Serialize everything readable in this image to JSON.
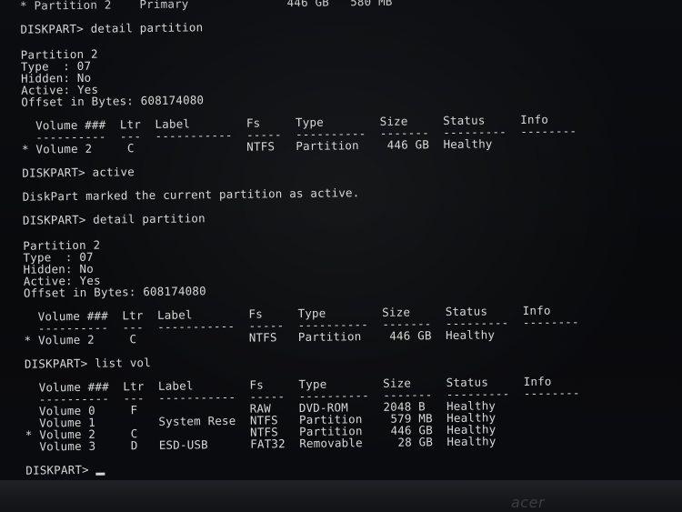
{
  "terminal": {
    "lines": [
      "* Partition 2    Primary              446 GB   580 MB",
      "DISKPART> detail partition",
      "Partition 2",
      "Type  : 07",
      "Hidden: No",
      "Active: Yes",
      "Offset in Bytes: 608174080",
      "  Volume ###  Ltr  Label        Fs     Type        Size     Status     Info",
      "  ----------  ---  -----------  -----  ----------  -------  ---------  --------",
      "* Volume 2     C                NTFS   Partition    446 GB  Healthy",
      "DISKPART> active",
      "DiskPart marked the current partition as active.",
      "DISKPART> detail partition",
      "Partition 2",
      "Type  : 07",
      "Hidden: No",
      "Active: Yes",
      "Offset in Bytes: 608174080",
      "  Volume ###  Ltr  Label        Fs     Type        Size     Status     Info",
      "  ----------  ---  -----------  -----  ----------  -------  ---------  --------",
      "* Volume 2     C                NTFS   Partition    446 GB  Healthy",
      "DISKPART> list vol",
      "  Volume ###  Ltr  Label        Fs     Type        Size     Status     Info",
      "  ----------  ---  -----------  -----  ----------  -------  ---------  --------",
      "  Volume 0     F                RAW    DVD-ROM     2048 B   Healthy",
      "  Volume 1         System Rese  NTFS   Partition    579 MB  Healthy",
      "* Volume 2     C                NTFS   Partition    446 GB  Healthy",
      "  Volume 3     D   ESD-USB      FAT32  Removable     28 GB  Healthy",
      "DISKPART> "
    ]
  },
  "monitor": {
    "brand": "acer"
  }
}
